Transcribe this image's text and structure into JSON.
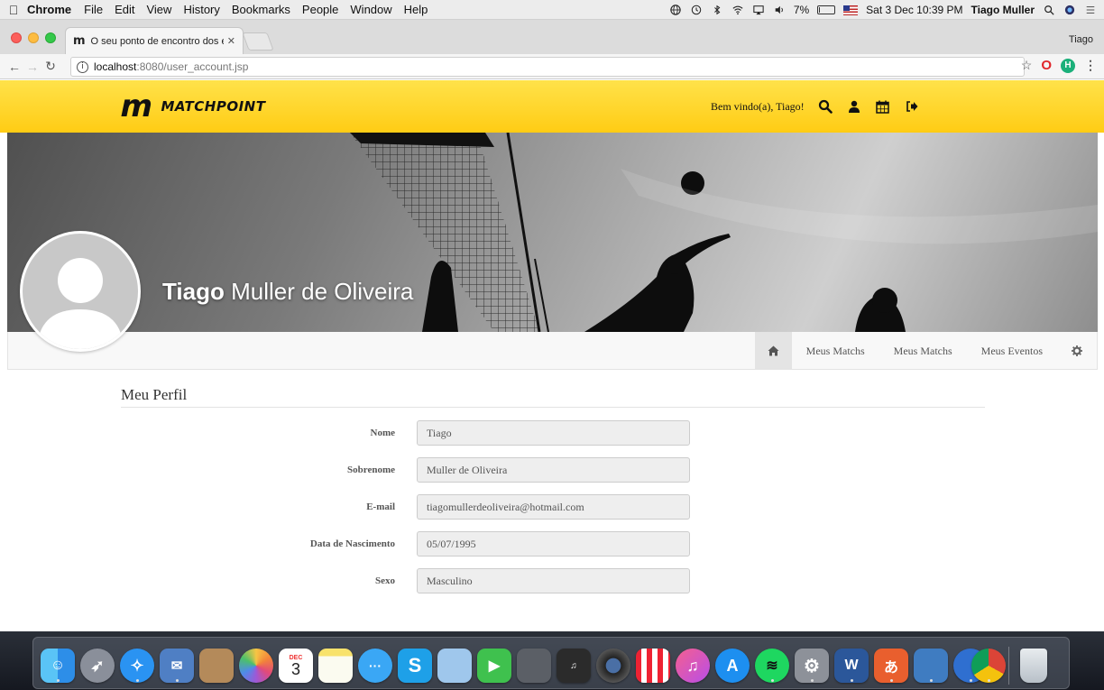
{
  "menubar": {
    "app_name": "Chrome",
    "items": [
      "File",
      "Edit",
      "View",
      "History",
      "Bookmarks",
      "People",
      "Window",
      "Help"
    ],
    "battery": "7%",
    "battery_level_fraction": 0.07,
    "datetime": "Sat 3 Dec  10:39 PM",
    "user": "Tiago Muller"
  },
  "browser": {
    "tab_title": "O seu ponto de encontro dos e",
    "profile_name": "Tiago",
    "url_host": "localhost",
    "url_path": ":8080/user_account.jsp"
  },
  "site": {
    "logo_text": "MATCHPOINT",
    "welcome": "Bem vindo(a), Tiago!",
    "header_icons": [
      "search-icon",
      "user-icon",
      "calendar-icon",
      "sign-out-icon"
    ]
  },
  "profile": {
    "first_name": "Tiago",
    "last_name": "Muller de Oliveira",
    "nav": [
      "Meus Matchs",
      "Meus Matchs",
      "Meus Eventos"
    ]
  },
  "form": {
    "title": "Meu Perfil",
    "fields": [
      {
        "label": "Nome",
        "value": "Tiago"
      },
      {
        "label": "Sobrenome",
        "value": "Muller de Oliveira"
      },
      {
        "label": "E-mail",
        "value": "tiagomullerdeoliveira@hotmail.com"
      },
      {
        "label": "Data de Nascimento",
        "value": "05/07/1995"
      },
      {
        "label": "Sexo",
        "value": "Masculino"
      }
    ]
  },
  "dock": {
    "calendar_day": "3",
    "calendar_month": "DEC",
    "apps": [
      "finder-icon",
      "launchpad-icon",
      "safari-icon",
      "mail-icon",
      "contacts-icon",
      "photos-icon",
      "calendar-icon",
      "notes-icon",
      "messages-icon",
      "skype-icon",
      "preview-icon",
      "facetime-icon",
      "photo-booth-icon",
      "guitar-app-icon",
      "camera-icon",
      "popcorn-icon",
      "itunes-icon",
      "app-store-icon",
      "spotify-icon",
      "system-preferences-icon",
      "word-icon",
      "translate-icon",
      "virtualbox-icon",
      "sourcetree-icon",
      "chrome-icon",
      "trash-icon"
    ]
  },
  "colors": {
    "header_yellow": "#ffd21e",
    "form_input_bg": "#eeeeee"
  }
}
